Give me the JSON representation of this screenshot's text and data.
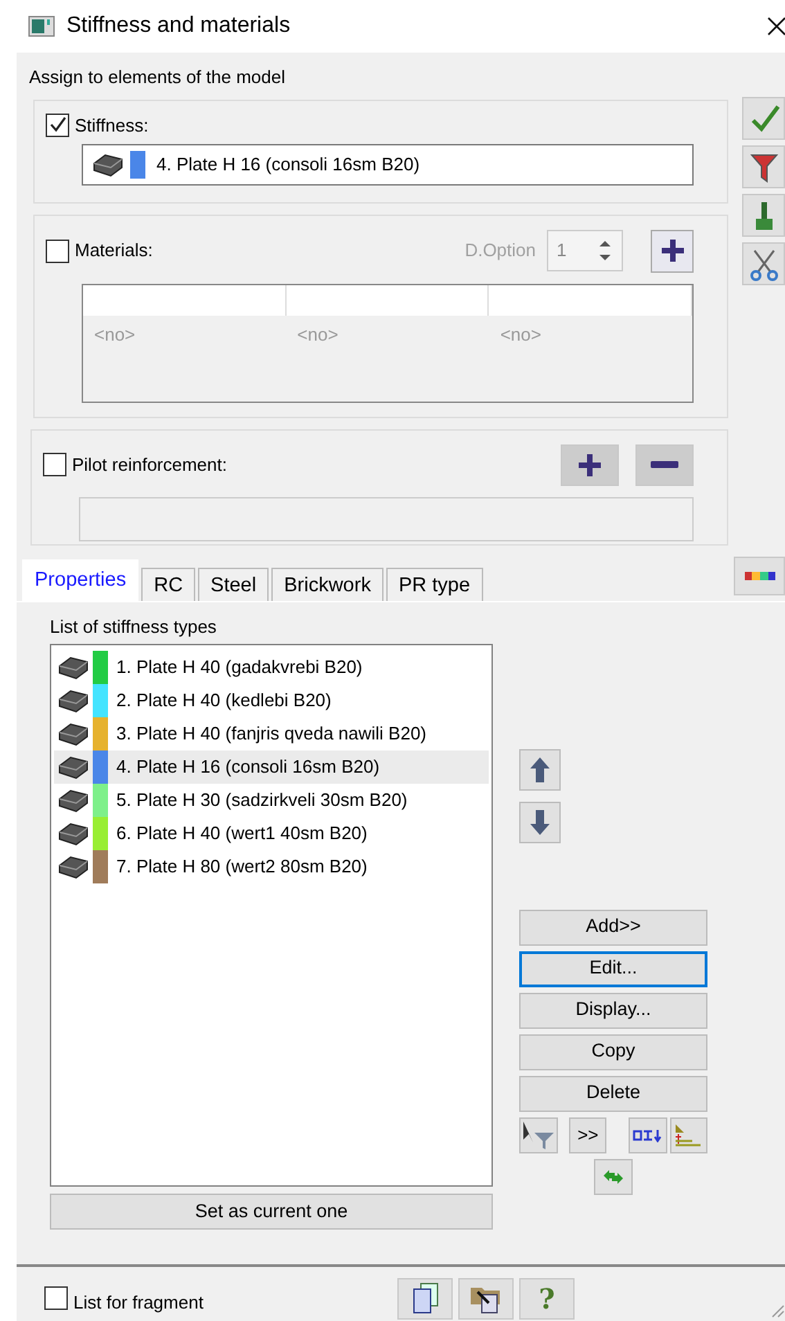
{
  "window": {
    "title": "Stiffness and materials"
  },
  "assign_label": "Assign to elements of the model",
  "stiffness": {
    "label": "Stiffness:",
    "checked": true,
    "value": "4. Plate H 16 (consoli 16sm B20)",
    "color": "#4a86e8"
  },
  "materials": {
    "label": "Materials:",
    "checked": false,
    "option_label": "D.Option",
    "option_value": "1",
    "cells": [
      "<no>",
      "<no>",
      "<no>"
    ]
  },
  "pilot": {
    "label": "Pilot reinforcement:",
    "checked": false
  },
  "tabs": [
    {
      "label": "Properties",
      "selected": true
    },
    {
      "label": "RC",
      "selected": false
    },
    {
      "label": "Steel",
      "selected": false
    },
    {
      "label": "Brickwork",
      "selected": false
    },
    {
      "label": "PR type",
      "selected": false
    }
  ],
  "list": {
    "title": "List of stiffness types",
    "items": [
      {
        "text": "1. Plate H 40 (gadakvrebi B20)",
        "color": "#22cc44",
        "selected": false
      },
      {
        "text": "2. Plate H 40 (kedlebi B20)",
        "color": "#44e4ff",
        "selected": false
      },
      {
        "text": "3. Plate H 40 (fanjris qveda nawili B20)",
        "color": "#e6b22e",
        "selected": false
      },
      {
        "text": "4. Plate H 16 (consoli 16sm B20)",
        "color": "#4a86e8",
        "selected": true
      },
      {
        "text": "5. Plate H 30 (sadzirkveli 30sm B20)",
        "color": "#7ef08a",
        "selected": false
      },
      {
        "text": "6. Plate H 40 (wert1 40sm B20)",
        "color": "#99ee33",
        "selected": false
      },
      {
        "text": "7. Plate H 80 (wert2 80sm B20)",
        "color": "#a07c5a",
        "selected": false
      }
    ]
  },
  "side_buttons": [
    {
      "label": "Add>>",
      "focused": false
    },
    {
      "label": "Edit...",
      "focused": true
    },
    {
      "label": "Display...",
      "focused": false
    },
    {
      "label": "Copy",
      "focused": false
    },
    {
      "label": "Delete",
      "focused": false
    }
  ],
  "more_button": ">>",
  "set_current": "Set as current one",
  "footer": {
    "fragment": {
      "label": "List for fragment",
      "checked": false
    },
    "help": "?"
  }
}
